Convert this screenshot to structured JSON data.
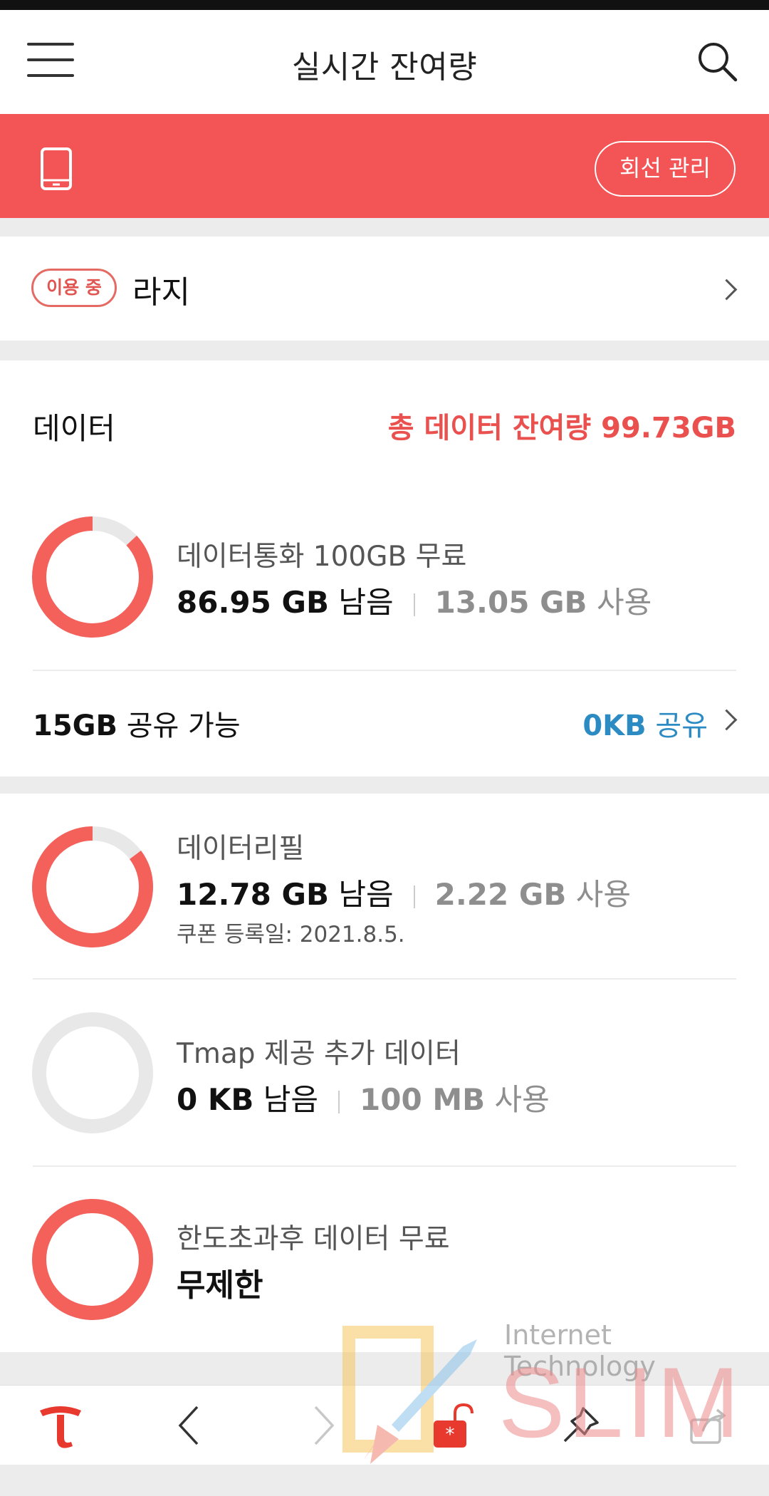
{
  "header": {
    "title": "실시간 잔여량"
  },
  "line_bar": {
    "manage_label": "회선 관리"
  },
  "plan": {
    "badge": "이용 중",
    "name": "라지"
  },
  "data_section": {
    "label": "데이터",
    "total": "총 데이터 잔여량 99.73GB",
    "main": {
      "title": "데이터통화 100GB 무료",
      "remaining": "86.95 GB",
      "remaining_suffix": "남음",
      "used": "13.05 GB",
      "used_suffix": "사용",
      "remaining_fraction": 0.8695
    },
    "share": {
      "amount": "15GB",
      "amount_suffix": "공유 가능",
      "shared": "0KB",
      "shared_suffix": "공유"
    }
  },
  "extra_items": [
    {
      "title": "데이터리필",
      "remaining": "12.78 GB",
      "remaining_suffix": "남음",
      "used": "2.22 GB",
      "used_suffix": "사용",
      "sub": "쿠폰 등록일: 2021.8.5.",
      "remaining_fraction": 0.852
    },
    {
      "title": "Tmap 제공 추가 데이터",
      "remaining": "0 KB",
      "remaining_suffix": "남음",
      "used": "100 MB",
      "used_suffix": "사용",
      "remaining_fraction": 0
    },
    {
      "title": "한도초과후 데이터 무료",
      "value": "무제한",
      "remaining_fraction": 1
    }
  ],
  "watermark": {
    "text": "Internet Technology",
    "logo": "SLIM"
  },
  "colors": {
    "accent": "#f35456",
    "ring": "#f4605a",
    "ring_track": "#e8e8e8",
    "share_blue": "#2d8bc4"
  }
}
